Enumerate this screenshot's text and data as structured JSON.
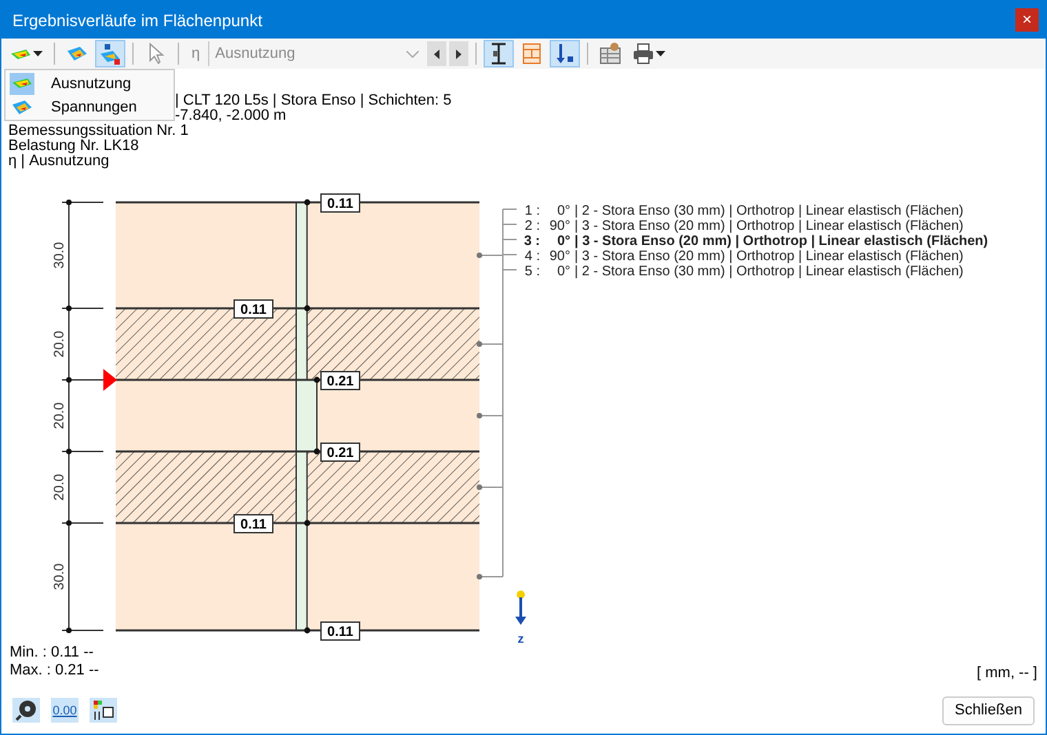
{
  "window": {
    "title": "Ergebnisverläufe im Flächenpunkt",
    "close": "×"
  },
  "toolbar": {
    "buttons_left": [
      {
        "kind": "contour",
        "pressed": false,
        "dropdown": true
      },
      {
        "kind": "surface",
        "pressed": false,
        "dropdown": false
      },
      {
        "kind": "numbered",
        "pressed": true,
        "dropdown": false
      },
      {
        "kind": "pointer",
        "pressed": false,
        "dropdown": false
      }
    ],
    "prefix": "η",
    "combo": {
      "value": "Ausnutzung",
      "disabled": true
    },
    "buttons_right": [
      {
        "kind": "section",
        "pressed": true,
        "dropdown": false
      },
      {
        "kind": "layers",
        "pressed": false,
        "dropdown": false
      },
      {
        "kind": "zaxis",
        "pressed": true,
        "dropdown": false
      },
      {
        "kind": "table",
        "pressed": false,
        "dropdown": false
      },
      {
        "kind": "print",
        "pressed": false,
        "dropdown": true
      }
    ]
  },
  "menu": [
    {
      "label": "Ausnutzung",
      "selected": true
    },
    {
      "label": "Spannungen",
      "selected": false
    }
  ],
  "info": [
    {
      "text": "| CLT 120 L5s | Stora Enso | Schichten: 5",
      "kind": "cut"
    },
    {
      "text": "-7.840, -2.000 m",
      "kind": "cut"
    },
    {
      "text": "Bemessungssituation Nr. 1",
      "kind": "full"
    },
    {
      "text": "Belastung Nr. LK18",
      "kind": "full"
    },
    {
      "text": "η | Ausnutzung",
      "kind": "full"
    }
  ],
  "layers": [
    {
      "thickness": "30.0",
      "hatched": false
    },
    {
      "thickness": "20.0",
      "hatched": true
    },
    {
      "thickness": "20.0",
      "hatched": false
    },
    {
      "thickness": "20.0",
      "hatched": true
    },
    {
      "thickness": "30.0",
      "hatched": false
    }
  ],
  "boundaries": [
    {
      "value": "0.11",
      "kind": "right",
      "marked": false
    },
    {
      "value": "0.11",
      "kind": "left",
      "marked": false
    },
    {
      "value": "0.21",
      "kind": "right",
      "marked": true
    },
    {
      "value": "0.21",
      "kind": "right",
      "marked": false
    },
    {
      "value": "0.11",
      "kind": "left",
      "marked": false
    },
    {
      "value": "0.11",
      "kind": "right",
      "marked": false
    }
  ],
  "legend": [
    {
      "number": "1 :",
      "angle": "0°",
      "text": "| 2 - Stora Enso (30 mm) | Orthotrop | Linear elastisch (Flächen)",
      "selected": false
    },
    {
      "number": "2 :",
      "angle": "90°",
      "text": "| 3 - Stora Enso (20 mm) | Orthotrop | Linear elastisch (Flächen)",
      "selected": false
    },
    {
      "number": "3 :",
      "angle": "0°",
      "text": "| 3 - Stora Enso (20 mm) | Orthotrop | Linear elastisch (Flächen)",
      "selected": true
    },
    {
      "number": "4 :",
      "angle": "90°",
      "text": "| 3 - Stora Enso (20 mm) | Orthotrop | Linear elastisch (Flächen)",
      "selected": false
    },
    {
      "number": "5 :",
      "angle": "0°",
      "text": "| 2 - Stora Enso (30 mm) | Orthotrop | Linear elastisch (Flächen)",
      "selected": false
    }
  ],
  "axis": "z",
  "summary": [
    "Min. : 0.11 --",
    "Max. : 0.21 --"
  ],
  "units": "[ mm, -- ]",
  "footer_buttons": [
    {
      "kind": "help"
    },
    {
      "kind": "decimals",
      "label": "0.00"
    },
    {
      "kind": "colors"
    }
  ],
  "close_button": "Schließen"
}
